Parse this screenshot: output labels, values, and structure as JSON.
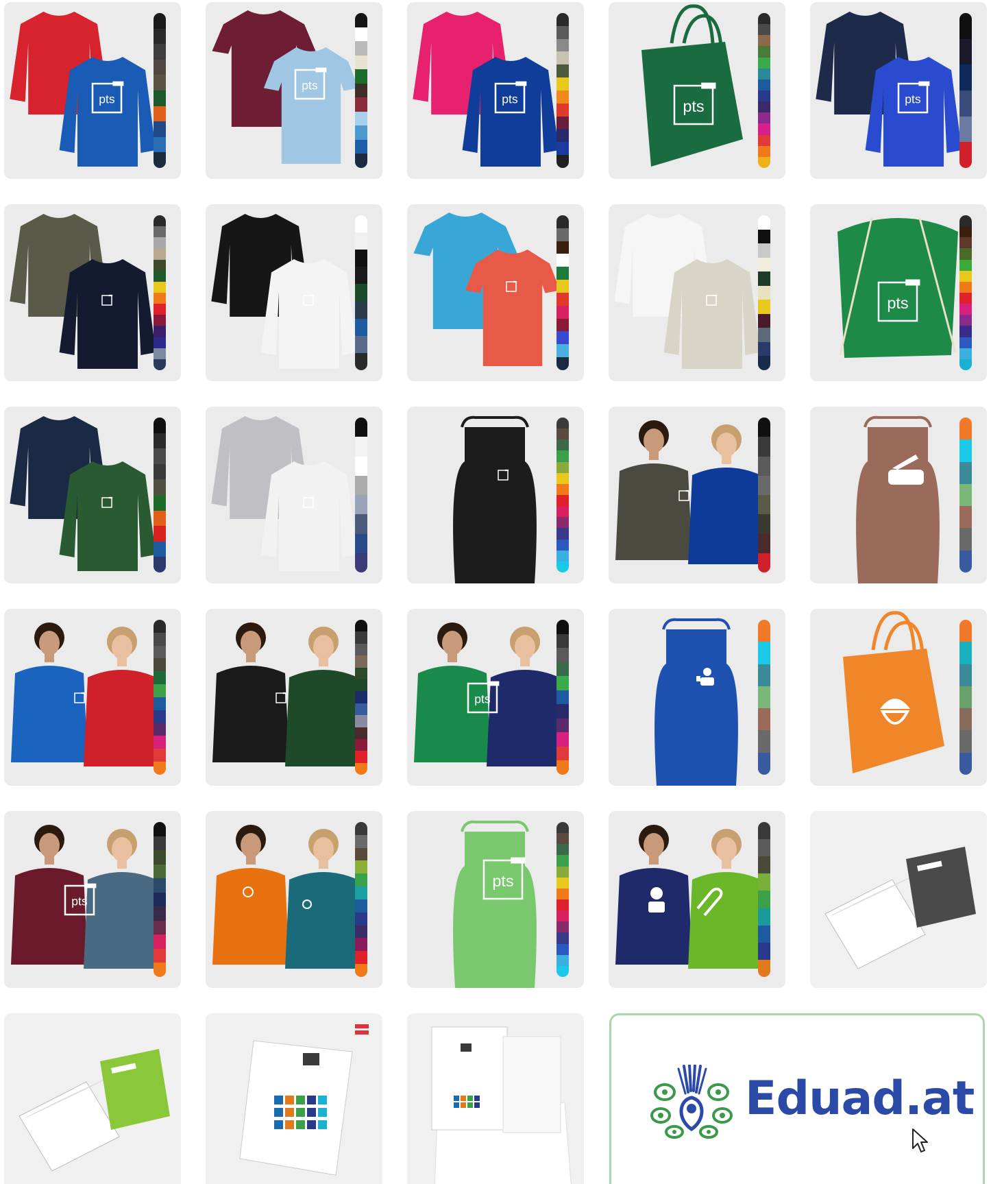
{
  "colors": {
    "tile_bg": "#ebebeb",
    "brand_blue": "#2b4aa8",
    "brand_green": "#3a9a4a",
    "card_border": "#a8d6a8"
  },
  "tiles": [
    {
      "product": "longsleeve-pair",
      "print": "pts",
      "garments": [
        "#d8232f",
        "#1a5cb5"
      ],
      "swatches": [
        "#1a1a1a",
        "#2a2a2a",
        "#3d3d3d",
        "#504840",
        "#5a5242",
        "#1d5a2a",
        "#e0601a",
        "#1e4a8a",
        "#2a6fb5",
        "#1c2a40"
      ]
    },
    {
      "product": "polo-pair",
      "print": "pts",
      "garments": [
        "#6e1e34",
        "#9fc7e3"
      ],
      "swatches": [
        "#141414",
        "#ffffff",
        "#b9b9b9",
        "#e8e2cf",
        "#1f6b2c",
        "#3d2f28",
        "#8a2a3a",
        "#a8d0ec",
        "#4a9ad0",
        "#1c5ea8",
        "#1c2a40"
      ]
    },
    {
      "product": "sweater-pair",
      "print": "pts",
      "garments": [
        "#e8216e",
        "#103d9a"
      ],
      "swatches": [
        "#2a2a2a",
        "#5a5a5a",
        "#8a8a8a",
        "#c8c2b0",
        "#4a5a3a",
        "#e8c81a",
        "#f08a1a",
        "#e03a2a",
        "#6a1e3a",
        "#2a2a6a",
        "#1a3aa0",
        "#202020"
      ]
    },
    {
      "product": "tote-bag",
      "print": "pts-large",
      "garments": [
        "#1a6b40"
      ],
      "swatches": [
        "#2a2a2a",
        "#4a4a4a",
        "#8a6a4a",
        "#4a7a3a",
        "#3aaa4a",
        "#2a8a9a",
        "#1e5aa0",
        "#2a3a8a",
        "#3a2a6a",
        "#8a2a8a",
        "#d8208a",
        "#e03a3a",
        "#f07a1a",
        "#f0b01a"
      ]
    },
    {
      "product": "zip-jacket-pair",
      "print": "pts",
      "garments": [
        "#1e2a4a",
        "#2a4ad0"
      ],
      "swatches": [
        "#101010",
        "#1a1a2a",
        "#0e2a5a",
        "#3a4a7a",
        "#6a7aa0",
        "#d0202a"
      ]
    },
    {
      "product": "longsleeve-pair",
      "print": "pts-small",
      "garments": [
        "#5a5a48",
        "#141a30"
      ],
      "swatches": [
        "#2a2a2a",
        "#6a6a6a",
        "#a8a8a8",
        "#b8a890",
        "#3a4a2a",
        "#1e5a2a",
        "#e8c81a",
        "#f07a1a",
        "#e0202a",
        "#8a1a3a",
        "#3a1e6a",
        "#2a2a8a",
        "#7a8aa0",
        "#2a3a5a"
      ]
    },
    {
      "product": "longsleeve-pair",
      "print": "pts-small",
      "garments": [
        "#161616",
        "#f4f4f4"
      ],
      "swatches": [
        "#ffffff",
        "#f0f0f0",
        "#101010",
        "#1a1a1a",
        "#1a4a2a",
        "#2a3a4a",
        "#1e5aa0",
        "#5a6a8a",
        "#2a2a2a"
      ]
    },
    {
      "product": "polo-pair",
      "print": "pts-small",
      "garments": [
        "#38a6d6",
        "#e85a48"
      ],
      "swatches": [
        "#2a2a2a",
        "#6a6a6a",
        "#3a2010",
        "#ffffff",
        "#1e7a3a",
        "#e8c81a",
        "#e03a2a",
        "#d82060",
        "#8a1a3a",
        "#3a4ad0",
        "#4ab0e0",
        "#1c2a40"
      ]
    },
    {
      "product": "longsleeve-pair",
      "print": "pts-small",
      "garments": [
        "#f6f6f6",
        "#d8d4c8"
      ],
      "swatches": [
        "#ffffff",
        "#101010",
        "#c8c8c8",
        "#f0ecdc",
        "#1e3a2a",
        "#e8e2c0",
        "#e8c81a",
        "#4a1a2a",
        "#5a6a7a",
        "#2a3a6a",
        "#1a2a4a"
      ]
    },
    {
      "product": "gym-bag",
      "print": "pts-large",
      "garments": [
        "#1e8a48"
      ],
      "swatches": [
        "#2a2a2a",
        "#3a2010",
        "#5a3a2a",
        "#4a6a2a",
        "#3aaa3a",
        "#e8c81a",
        "#f07a1a",
        "#e0202a",
        "#d82080",
        "#8a2a8a",
        "#3a2a8a",
        "#2a5ac0",
        "#3ab0e0",
        "#1ab0d0"
      ]
    },
    {
      "product": "longsleeve-pair",
      "print": "pts-small",
      "garments": [
        "#1a2a44",
        "#2a5a32"
      ],
      "swatches": [
        "#101010",
        "#2a2a2a",
        "#4a4a4a",
        "#3a3a3a",
        "#505040",
        "#1e6a2a",
        "#e0601a",
        "#d82020",
        "#1e5aa0",
        "#2a3a6a"
      ]
    },
    {
      "product": "zip-jacket-pair",
      "print": "pts-small",
      "garments": [
        "#c0c0c4",
        "#f2f2f2"
      ],
      "swatches": [
        "#101010",
        "#f4f4f4",
        "#ffffff",
        "#aaaaaa",
        "#9aa4b8",
        "#4a5a7a",
        "#2a4a8a",
        "#3a3a7a"
      ]
    },
    {
      "product": "apron",
      "print": "pts-small",
      "garments": [
        "#1c1c1c"
      ],
      "swatches": [
        "#3a3a3a",
        "#5a4a40",
        "#3a6a4a",
        "#3aa04a",
        "#8aaa3a",
        "#e8c81a",
        "#f07a1a",
        "#e0202a",
        "#d82060",
        "#8a2a6a",
        "#3a3a8a",
        "#2a5ac0",
        "#3ab0e0",
        "#1ac8e8"
      ]
    },
    {
      "product": "hoodie-models",
      "print": "pts-small",
      "garments": [
        "#4a4a40",
        "#0e3a9a"
      ],
      "swatches": [
        "#101010",
        "#3a3a3a",
        "#5a5a5a",
        "#6a6a6a",
        "#5a5a48",
        "#3a3a30",
        "#4a2a2a",
        "#d0202a"
      ]
    },
    {
      "product": "apron",
      "print": "tool-icon",
      "garments": [
        "#9a6a5a"
      ],
      "swatches": [
        "#f07a2a",
        "#1ac8e8",
        "#3a8a9a",
        "#7ab87a",
        "#9a6a5a",
        "#6a6a6a",
        "#3a5aa0"
      ]
    },
    {
      "product": "tshirt-models",
      "print": "pts-small",
      "garments": [
        "#1a64c0",
        "#d0202a"
      ],
      "swatches": [
        "#2a2a2a",
        "#4a4a4a",
        "#5a5a5a",
        "#4a4a3a",
        "#1e6a3a",
        "#3aa04a",
        "#1e5aa0",
        "#2a3a8a",
        "#5a2a6a",
        "#d8207a",
        "#e03a3a",
        "#f07a1a"
      ]
    },
    {
      "product": "hoodie-models",
      "print": "pts-small",
      "garments": [
        "#1a1a1a",
        "#1e4a2a"
      ],
      "swatches": [
        "#101010",
        "#3a3a3a",
        "#5a5a5a",
        "#7a6a5a",
        "#2a4a2a",
        "#1e4a2a",
        "#1a2a6a",
        "#3a5aa0",
        "#8a8aa0",
        "#4a2a2a",
        "#8a1a3a",
        "#e0202a",
        "#f07a1a"
      ]
    },
    {
      "product": "tshirt-models",
      "print": "pts",
      "garments": [
        "#1a8a4a",
        "#1e2a6a"
      ],
      "swatches": [
        "#101010",
        "#3a3a3a",
        "#5a5a5a",
        "#3a6a4a",
        "#3aaa4a",
        "#1e5aa0",
        "#2a2a6a",
        "#5a2a6a",
        "#d82080",
        "#e03a3a",
        "#f07a1a"
      ]
    },
    {
      "product": "apron",
      "print": "person-icon",
      "garments": [
        "#1e50b0"
      ],
      "swatches": [
        "#f07a2a",
        "#1ac8e8",
        "#3a8a9a",
        "#7ab87a",
        "#9a6a5a",
        "#6a6a6a",
        "#3a5aa0"
      ]
    },
    {
      "product": "tote-bag",
      "print": "face-icon",
      "garments": [
        "#f0862a"
      ],
      "swatches": [
        "#f07a2a",
        "#1ab0c0",
        "#3a8a9a",
        "#6aa06a",
        "#8a6a5a",
        "#6a6a6a",
        "#3a5aa0"
      ]
    },
    {
      "product": "hoodie-models",
      "print": "pts",
      "garments": [
        "#6a1a2a",
        "#4a6a84"
      ],
      "swatches": [
        "#101010",
        "#3a3a3a",
        "#3a4a2a",
        "#4a6a3a",
        "#2a4a6a",
        "#1e2a5a",
        "#3a2a4a",
        "#6a2a4a",
        "#d82060",
        "#e03a3a",
        "#f07a1a"
      ]
    },
    {
      "product": "tshirt-models",
      "print": "small-icons",
      "garments": [
        "#e8700e",
        "#1a6a7a"
      ],
      "swatches": [
        "#3a3a3a",
        "#6a6a6a",
        "#5a4a3a",
        "#8ab03a",
        "#3aa04a",
        "#1aa0a0",
        "#1e5aa0",
        "#2a3a8a",
        "#3a2a6a",
        "#8a1a5a",
        "#e0202a",
        "#f07a1a"
      ]
    },
    {
      "product": "apron",
      "print": "pts-large",
      "garments": [
        "#7ac86e"
      ],
      "swatches": [
        "#3a3a3a",
        "#5a4a40",
        "#3a6a4a",
        "#3aa04a",
        "#8aaa3a",
        "#e8c81a",
        "#f07a1a",
        "#e0202a",
        "#d82060",
        "#8a2a6a",
        "#3a3a8a",
        "#2a5ac0",
        "#3ab0e0",
        "#1ac8e8"
      ]
    },
    {
      "product": "tshirt-models",
      "print": "big-icons",
      "garments": [
        "#1e2a6a",
        "#6ab82a"
      ],
      "swatches": [
        "#3a3a3a",
        "#5a5a5a",
        "#4a4a3a",
        "#7ab03a",
        "#3aa04a",
        "#1a9a9a",
        "#1e5aa0",
        "#2a3a8a",
        "#e07a1a"
      ]
    },
    {
      "product": "notebooks-grey",
      "print": "none",
      "garments": [
        "#4a4a4a"
      ],
      "swatches": []
    },
    {
      "product": "notebooks-green",
      "print": "none",
      "garments": [
        "#8ac83a"
      ],
      "swatches": []
    },
    {
      "product": "brochure-stack",
      "print": "none",
      "garments": [
        "#ffffff"
      ],
      "swatches": []
    },
    {
      "product": "folder-set",
      "print": "none",
      "garments": [
        "#ffffff"
      ],
      "swatches": []
    }
  ],
  "brand": {
    "name": "Eduad.at"
  }
}
